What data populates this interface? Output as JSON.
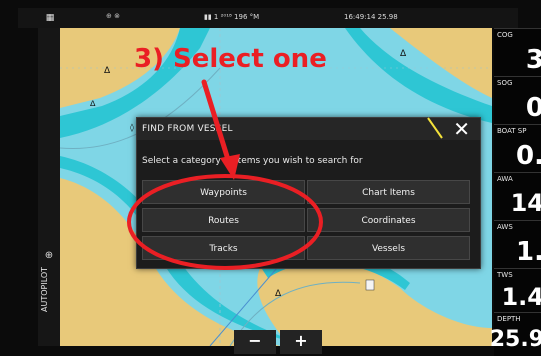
{
  "status_bar": {
    "menu_icon": "grid-icon",
    "gps_text": "▮▮ 1 ²⁰¹⁸ 196 °M",
    "clock_text": "16:49:14  25.98"
  },
  "sidebar": {
    "autopilot_label": "AUTOPILOT"
  },
  "instruments": [
    {
      "label": "COG",
      "value": "3"
    },
    {
      "label": "SOG",
      "value": "0"
    },
    {
      "label": "BOAT SP",
      "value": "0."
    },
    {
      "label": "AWA",
      "value": "14"
    },
    {
      "label": "AWS",
      "value": "1."
    },
    {
      "label": "TWS",
      "value": "1.4"
    },
    {
      "label": "DEPTH",
      "value": "25.9"
    }
  ],
  "dialog": {
    "title": "FIND FROM VESSEL",
    "close_icon": "close-icon",
    "prompt": "Select a category of items you wish to search for",
    "buttons": {
      "waypoints": "Waypoints",
      "chart_items": "Chart Items",
      "routes": "Routes",
      "coordinates": "Coordinates",
      "tracks": "Tracks",
      "vessels": "Vessels"
    }
  },
  "zoom": {
    "out_label": "−",
    "in_label": "+"
  },
  "annotation": {
    "text": "3) Select one",
    "color": "#ea1f24"
  },
  "colors": {
    "water": "#7fd6e6",
    "land": "#e8c97a",
    "shallow": "#2ec6d4",
    "dialog_bg": "#1c1c1c"
  }
}
